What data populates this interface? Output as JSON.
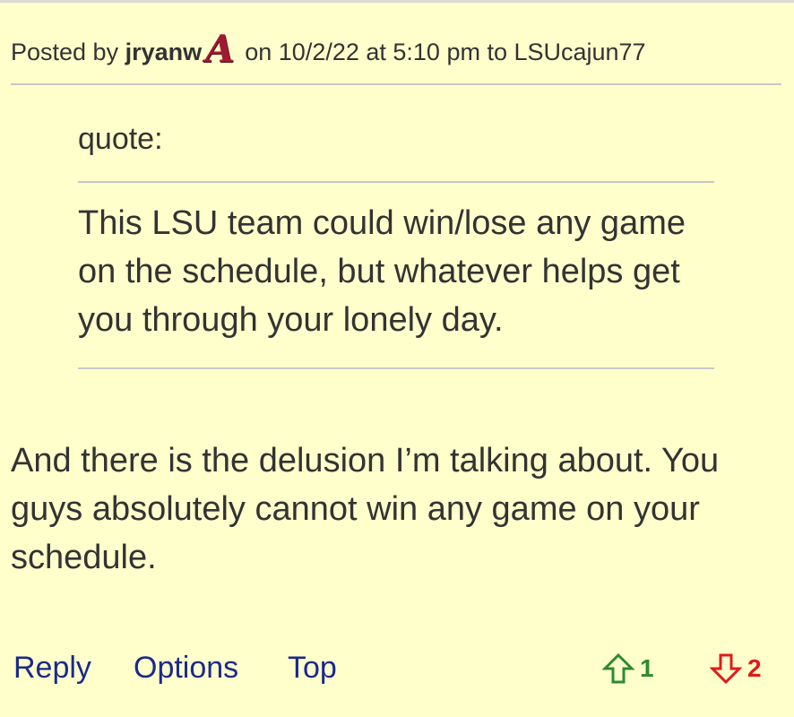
{
  "header": {
    "posted_by_prefix": "Posted by",
    "author": "jryanw",
    "team_logo_glyph": "A",
    "suffix": "on 10/2/22 at 5:10 pm to LSUcajun77"
  },
  "quote": {
    "label": "quote:",
    "text": "This LSU team could win/lose any game on the schedule, but whatever helps get you through your lonely day."
  },
  "body": {
    "text": "And there is the delusion I’m talking about. You guys absolutely cannot win any game on your schedule."
  },
  "actions": {
    "reply": "Reply",
    "options": "Options",
    "top": "Top"
  },
  "votes": {
    "up": "1",
    "down": "2",
    "up_color": "#2e8b2e",
    "down_color": "#e01b1b",
    "up_icon": "arrow-up-icon",
    "down_icon": "arrow-down-icon"
  },
  "colors": {
    "background": "#ffffcc",
    "link": "#1a2a8c",
    "logo": "#9e1b32"
  }
}
